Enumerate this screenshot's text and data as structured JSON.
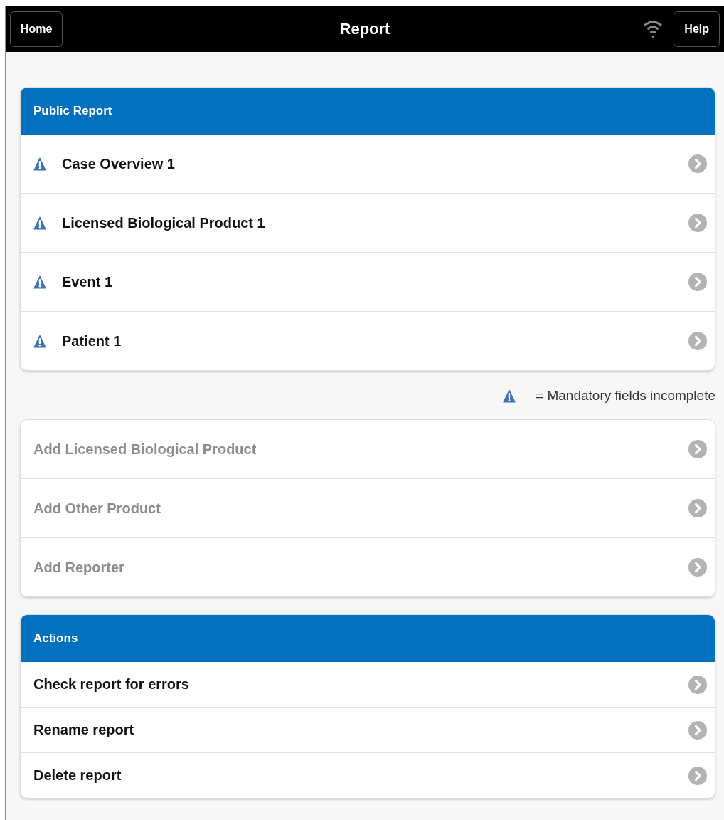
{
  "header": {
    "left_button": "Home",
    "title": "Report",
    "right_button": "Help"
  },
  "public_report": {
    "title": "Public Report",
    "items": [
      {
        "label": "Case Overview 1",
        "incomplete": true
      },
      {
        "label": "Licensed Biological Product 1",
        "incomplete": true
      },
      {
        "label": "Event 1",
        "incomplete": true
      },
      {
        "label": "Patient 1",
        "incomplete": true
      }
    ]
  },
  "legend": "= Mandatory fields incomplete",
  "add_items": [
    {
      "label": "Add Licensed Biological Product",
      "disabled": true
    },
    {
      "label": "Add Other Product",
      "disabled": true
    },
    {
      "label": "Add Reporter",
      "disabled": true
    }
  ],
  "actions": {
    "title": "Actions",
    "items": [
      {
        "label": "Check report for errors"
      },
      {
        "label": "Rename report"
      },
      {
        "label": "Delete report"
      }
    ]
  }
}
